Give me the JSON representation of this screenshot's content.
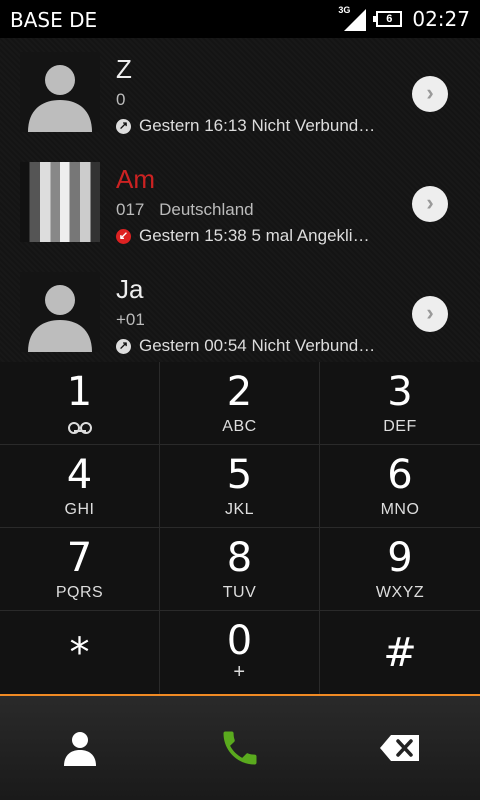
{
  "status_bar": {
    "carrier": "BASE DE",
    "network": "3G",
    "battery_level": "6",
    "time": "02:27"
  },
  "call_log": [
    {
      "name": "Z",
      "number": "0",
      "location": "",
      "call_type": "outgoing",
      "detail": "Gestern 16:13 Nicht Verbund…",
      "missed": false,
      "avatar": "placeholder"
    },
    {
      "name": "Am",
      "number": "017",
      "location": "Deutschland",
      "call_type": "missed",
      "detail": "Gestern 15:38 5 mal Angekli…",
      "missed": true,
      "avatar": "photo"
    },
    {
      "name": "Ja",
      "number": "+01",
      "location": "",
      "call_type": "outgoing",
      "detail": "Gestern 00:54 Nicht Verbund…",
      "missed": false,
      "avatar": "placeholder"
    }
  ],
  "dialpad": {
    "keys": [
      {
        "digit": "1",
        "letters": "",
        "voicemail": true
      },
      {
        "digit": "2",
        "letters": "ABC"
      },
      {
        "digit": "3",
        "letters": "DEF"
      },
      {
        "digit": "4",
        "letters": "GHI"
      },
      {
        "digit": "5",
        "letters": "JKL"
      },
      {
        "digit": "6",
        "letters": "MNO"
      },
      {
        "digit": "7",
        "letters": "PQRS"
      },
      {
        "digit": "8",
        "letters": "TUV"
      },
      {
        "digit": "9",
        "letters": "WXYZ"
      },
      {
        "digit": "*",
        "letters": ""
      },
      {
        "digit": "0",
        "letters": "+"
      },
      {
        "digit": "#",
        "letters": ""
      }
    ]
  },
  "action_bar": {
    "contacts_icon": "person-icon",
    "call_icon": "phone-icon",
    "delete_icon": "backspace-icon",
    "call_color": "#5aaa1e",
    "accent_color": "#f08a24"
  }
}
